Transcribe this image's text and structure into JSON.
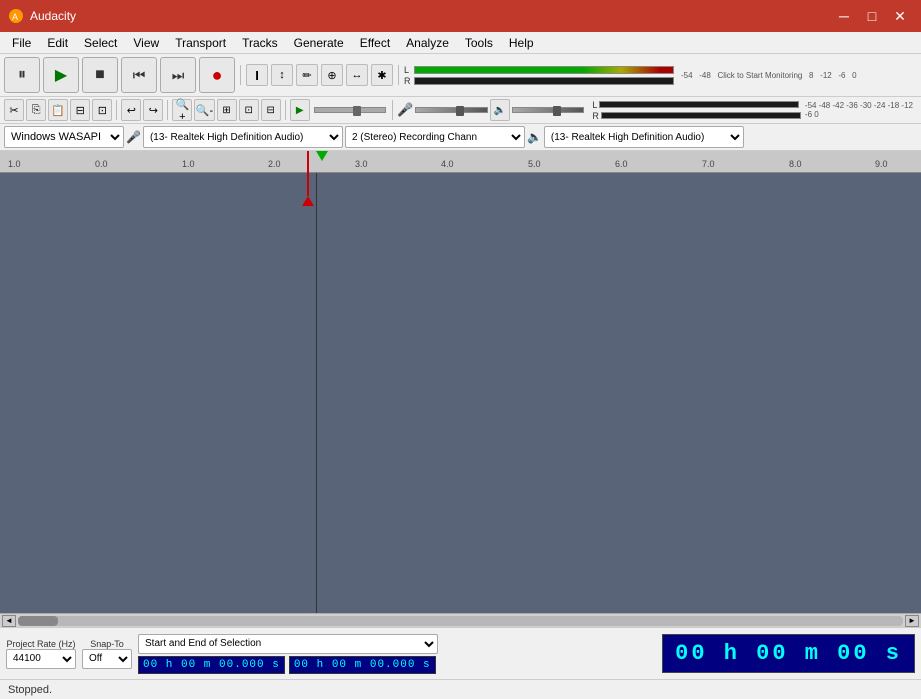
{
  "app": {
    "title": "Audacity",
    "status": "Stopped."
  },
  "titlebar": {
    "title": "Audacity",
    "minimize": "─",
    "maximize": "□",
    "close": "✕"
  },
  "menu": {
    "items": [
      "File",
      "Edit",
      "Select",
      "View",
      "Transport",
      "Tracks",
      "Generate",
      "Effect",
      "Analyze",
      "Tools",
      "Help"
    ]
  },
  "transport": {
    "pause": "⏸",
    "play": "▶",
    "stop": "■",
    "skip_start": "⏮",
    "skip_end": "⏭",
    "record": "●"
  },
  "tools": {
    "selection": "I",
    "envelope": "↕",
    "draw": "✏",
    "zoom": "🔍",
    "timeshift": "↔",
    "multi": "✱"
  },
  "audio_device": {
    "host": "Windows WASAPI",
    "input": "(13- Realtek High Definition Audio)",
    "channels": "2 (Stereo) Recording Chann",
    "output": "(13- Realtek High Definition Audio)"
  },
  "ruler": {
    "marks": [
      {
        "label": "1.0",
        "pos": 50
      },
      {
        "label": "0.0",
        "pos": 133
      },
      {
        "label": "1.0",
        "pos": 220
      },
      {
        "label": "2.0",
        "pos": 306
      },
      {
        "label": "3.0",
        "pos": 393
      },
      {
        "label": "4.0",
        "pos": 479
      },
      {
        "label": "5.0",
        "pos": 566
      },
      {
        "label": "6.0",
        "pos": 652
      },
      {
        "label": "7.0",
        "pos": 739
      },
      {
        "label": "8.0",
        "pos": 825
      },
      {
        "label": "9.0",
        "pos": 905
      }
    ]
  },
  "bottom_controls": {
    "project_rate_label": "Project Rate (Hz)",
    "snap_to_label": "Snap-To",
    "selection_format": "Start and End of Selection",
    "rate_value": "44100",
    "snap_value": "Off",
    "time_display": "00 h 00 m 00 s",
    "time_start": "00 h 00 m 00.000 s",
    "time_end": "00 h 00 m 00.000 s"
  },
  "status": {
    "text": "Stopped."
  },
  "meter": {
    "left_label": "L",
    "right_label": "R",
    "db_labels": [
      "-54",
      "-48",
      "Click to Start Monitoring",
      "8",
      "-12",
      "-6",
      "0"
    ],
    "db_labels2": [
      "-54",
      "-48",
      "-42",
      "-36",
      "-30",
      "-24",
      "-18",
      "-12",
      "-6",
      "0"
    ]
  }
}
